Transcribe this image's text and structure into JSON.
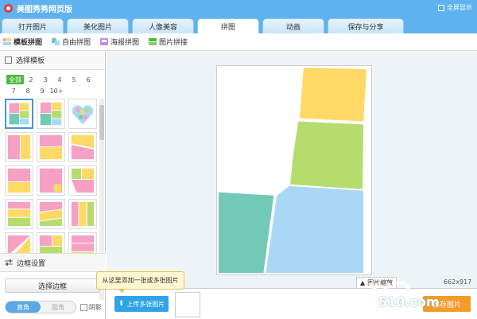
{
  "app": {
    "title": "美图秀秀网页版",
    "fullscreen_label": "全屏显示"
  },
  "tabs": [
    {
      "label": "打开图片"
    },
    {
      "label": "美化图片"
    },
    {
      "label": "人像美容"
    },
    {
      "label": "拼图",
      "active": true
    },
    {
      "label": "动画"
    },
    {
      "label": "保存与分享"
    }
  ],
  "subtoolbar": [
    {
      "label": "模板拼图",
      "active": true
    },
    {
      "label": "自由拼图"
    },
    {
      "label": "海报拼图"
    },
    {
      "label": "图片拼接"
    }
  ],
  "left_panel": {
    "header": "选择模板",
    "counts_row1": [
      "全部",
      "2",
      "3",
      "4",
      "5",
      "6"
    ],
    "counts_row2": [
      "7",
      "8",
      "9",
      "10+"
    ],
    "border_header": "边框设置",
    "select_border_label": "选择边框",
    "toggle": {
      "left": "直角",
      "right": "圆角"
    },
    "shadow_label": "阴影"
  },
  "canvas": {
    "zoom_label": "图片缩放",
    "dimensions": "662x917"
  },
  "bottom": {
    "tooltip": "从这里添加一张或多张图片",
    "upload_label": "上传多张图片",
    "save_label": "保存图片"
  },
  "watermark": {
    "domain": "510.com"
  },
  "colors": {
    "title_blue": "#5fb2f0",
    "accent_green": "#4cba3c",
    "upload_blue": "#2fa3e7",
    "save_orange": "#f39a2b",
    "tile_yellow": "#ffd966",
    "tile_green": "#b7dc6e",
    "tile_teal": "#72c9b6",
    "tile_blue": "#a9d8f7",
    "tile_pink": "#f6a1c4"
  },
  "icons": {
    "template": "grid-icon",
    "free": "collage-icon",
    "poster": "poster-icon",
    "stitch": "stitch-icon",
    "border": "sliders-icon",
    "upload": "arrow-up-icon"
  }
}
